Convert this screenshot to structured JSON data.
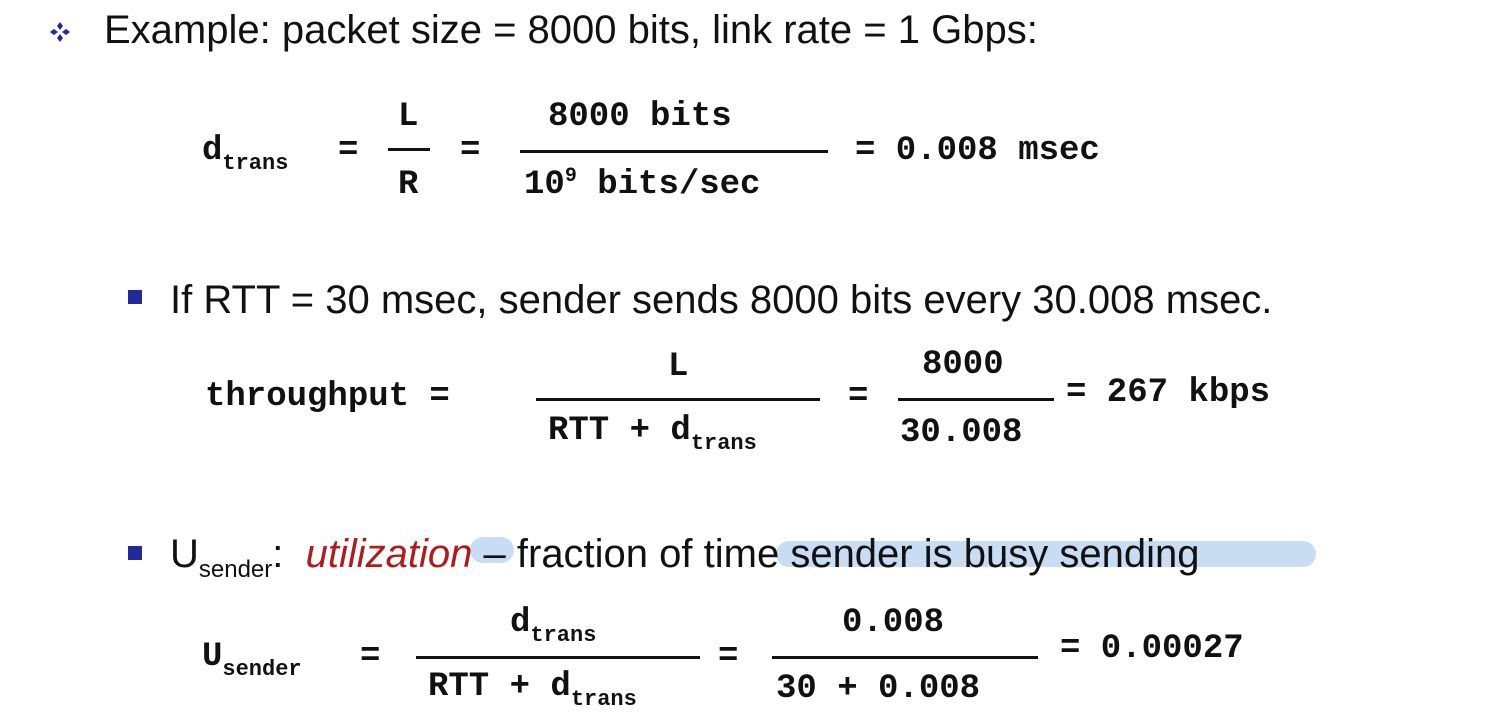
{
  "example": {
    "text": "Example: packet size = 8000 bits, link rate = 1 Gbps:"
  },
  "formula_trans": {
    "lhs_main": "d",
    "lhs_sub": "trans",
    "eq1": "=",
    "num1": "L",
    "den1": "R",
    "eq2": "=",
    "num2": "8000 bits",
    "den2_base": "10",
    "den2_exp": "9",
    "den2_rest": " bits/sec",
    "result": "= 0.008 msec"
  },
  "rtt_bullet": {
    "text": "If RTT = 30 msec, sender sends 8000 bits every 30.008 msec."
  },
  "formula_throughput": {
    "lhs": "throughput =",
    "num1": "L",
    "den1_main": "RTT + d",
    "den1_sub": "trans",
    "eq2": "=",
    "num2": "8000",
    "den2": "30.008",
    "result": "= 267 kbps"
  },
  "util_bullet": {
    "u_main": "U",
    "u_sub": "sender",
    "colon": ":",
    "utilization": "utilization",
    "rest": " – fraction of time sender is busy sending"
  },
  "formula_util": {
    "lhs_main": "U",
    "lhs_sub": "sender",
    "eq1": "=",
    "num1_main": "d",
    "num1_sub": "trans",
    "den1_main": "RTT + d",
    "den1_sub": "trans",
    "eq2": "=",
    "num2": "0.008",
    "den2": "30 + 0.008",
    "result": "= 0.00027"
  },
  "colors": {
    "bullet": "#1d2b9e",
    "utilization": "#b01c1c",
    "highlight": "#c8ddf3"
  },
  "icons": {
    "top_bullet": "four-diamond-bullet-icon",
    "sub_bullet": "square-bullet-icon"
  }
}
